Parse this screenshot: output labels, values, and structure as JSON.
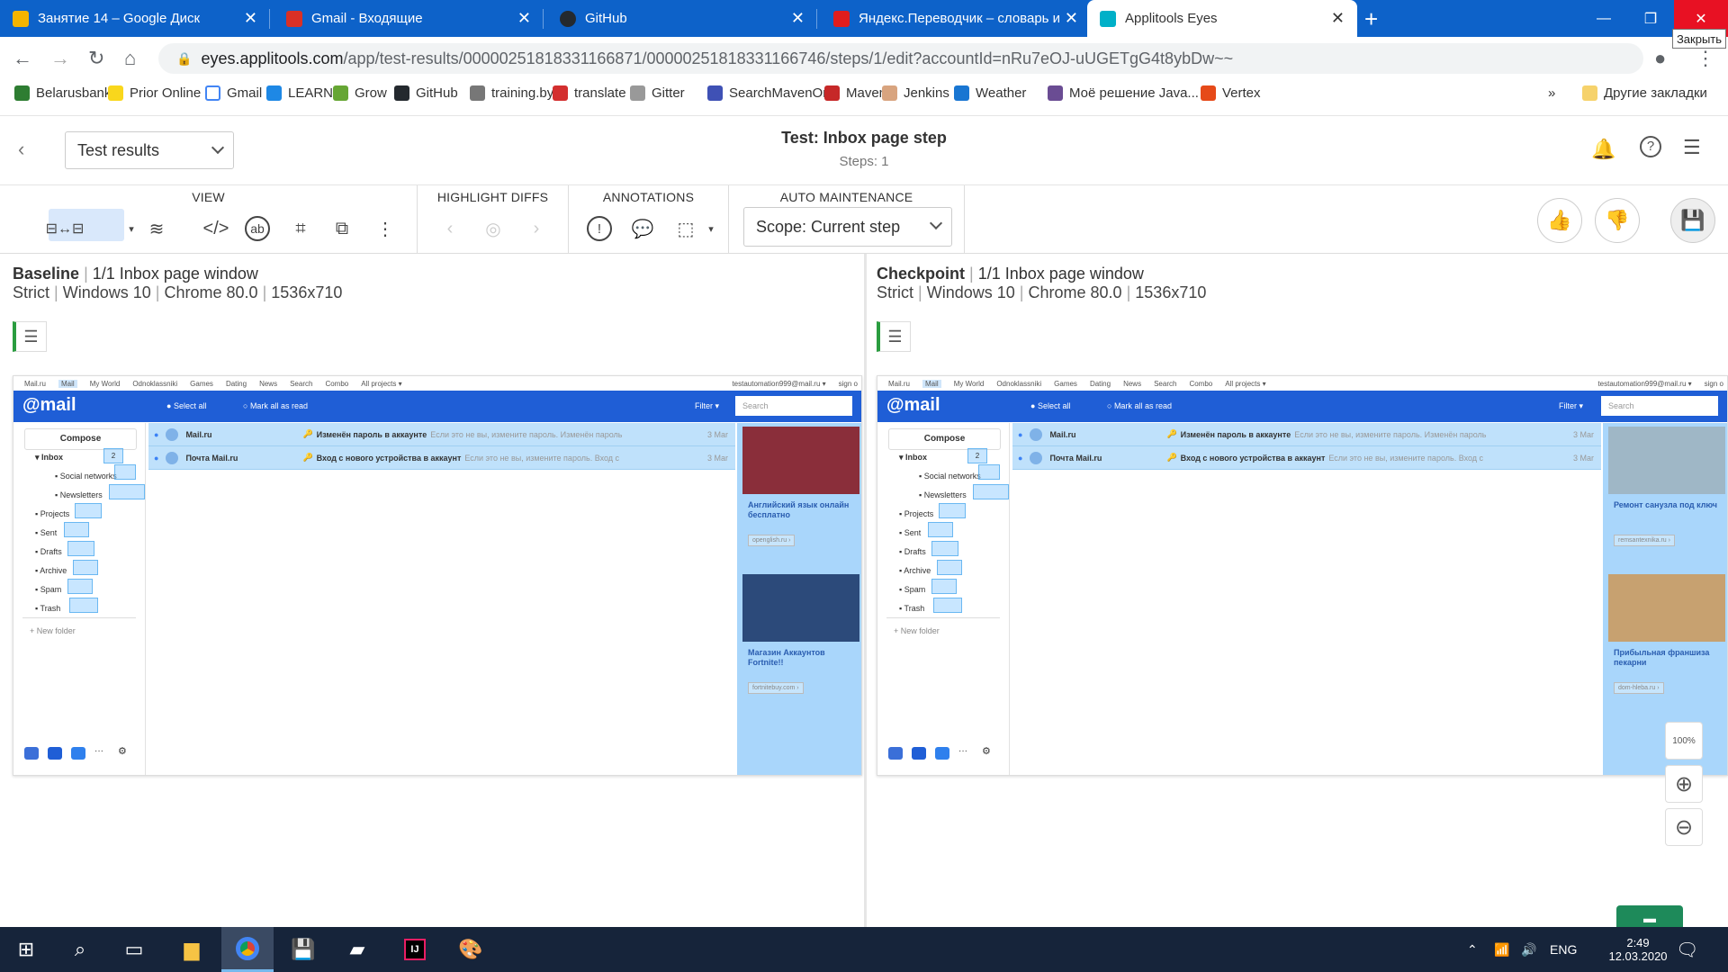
{
  "tabs": [
    {
      "label": "Занятие 14 – Google Диск",
      "color": "#f4b400"
    },
    {
      "label": "Gmail - Входящие",
      "color": "#d93025"
    },
    {
      "label": "GitHub",
      "color": "#24292e"
    },
    {
      "label": "Яндекс.Переводчик – словарь и",
      "color": "#e11d1d"
    },
    {
      "label": "Applitools Eyes",
      "color": "#00b0c8"
    }
  ],
  "window": {
    "close_tooltip": "Закрыть"
  },
  "address": {
    "host": "eyes.applitools.com",
    "path": "/app/test-results/00000251818331166871/00000251818331166746/steps/1/edit?accountId=nRu7eOJ-uUGETgG4t8ybDw~~"
  },
  "bookmarks": [
    {
      "label": "Belarusbank",
      "color": "#2e7d32"
    },
    {
      "label": "Prior Online",
      "color": "#f9d71c"
    },
    {
      "label": "Gmail",
      "color": "#ffffff"
    },
    {
      "label": "LEARN",
      "color": "#1e88e5"
    },
    {
      "label": "Grow",
      "color": "#66a634"
    },
    {
      "label": "GitHub",
      "color": "#24292e"
    },
    {
      "label": "training.by",
      "color": "#777777"
    },
    {
      "label": "translate",
      "color": "#d32f2f"
    },
    {
      "label": "Gitter",
      "color": "#999999"
    },
    {
      "label": "SearchMavenOrg",
      "color": "#3f51b5"
    },
    {
      "label": "Maven",
      "color": "#c62828"
    },
    {
      "label": "Jenkins",
      "color": "#d8a47f"
    },
    {
      "label": "Weather",
      "color": "#1976d2"
    },
    {
      "label": "Моё решение Java...",
      "color": "#6a4c93"
    },
    {
      "label": "Vertex",
      "color": "#e64a19"
    }
  ],
  "bookmarks_more": "»",
  "other_bookmarks": "Другие закладки",
  "appbar": {
    "dropdown": "Test results",
    "title": "Test: Inbox page step",
    "subtitle": "Steps: 1"
  },
  "toolbar": {
    "view_label": "VIEW",
    "highlight_label": "HIGHLIGHT DIFFS",
    "annotations_label": "ANNOTATIONS",
    "auto_label": "AUTO MAINTENANCE",
    "scope": "Scope: Current step"
  },
  "baseline": {
    "title": "Baseline",
    "window": "1/1 Inbox page window",
    "meta": [
      "Strict",
      "Windows 10",
      "Chrome 80.0",
      "1536x710"
    ]
  },
  "checkpoint": {
    "title": "Checkpoint",
    "window": "1/1 Inbox page window",
    "meta": [
      "Strict",
      "Windows 10",
      "Chrome 80.0",
      "1536x710"
    ]
  },
  "mail": {
    "top_links": [
      "Mail.ru",
      "Mail",
      "My World",
      "Odnoklassniki",
      "Games",
      "Dating",
      "News",
      "Search",
      "Combo",
      "All projects ▾"
    ],
    "account": "testautomation999@mail.ru ▾",
    "sign": "sign o",
    "logo": "@mail",
    "select_all": "Select all",
    "mark_read": "Mark all as read",
    "filter": "Filter ▾",
    "search": "Search",
    "compose": "Compose",
    "folders": [
      "Inbox",
      "Social networks",
      "Newsletters",
      "Projects",
      "Sent",
      "Drafts",
      "Archive",
      "Spam",
      "Trash"
    ],
    "inbox_count": "2",
    "new_folder": "New folder",
    "messages": [
      {
        "from": "Mail.ru",
        "subject": "Изменён пароль в аккаунте",
        "snippet": "Если это не вы, измените пароль. Изменён пароль",
        "date": "3 Mar"
      },
      {
        "from": "Почта Mail.ru",
        "subject": "Вход с нового устройства в аккаунт",
        "snippet": "Если это не вы, измените пароль. Вход с",
        "date": "3 Mar"
      }
    ]
  },
  "baseline_ads": [
    {
      "text": "Английский язык онлайн бесплатно",
      "link": "openglish.ru ›",
      "color": "#8a2e3a"
    },
    {
      "text": "Магазин Аккаунтов Fortnite!!",
      "link": "fortnitebuy.com ›",
      "color": "#2c4a7a"
    }
  ],
  "checkpoint_ads": [
    {
      "text": "Ремонт санузла под ключ",
      "link": "remsantexnika.ru ›",
      "color": "#9fb7c6"
    },
    {
      "text": "Прибыльная франшиза пекарни",
      "link": "dom-hleba.ru ›",
      "color": "#c7a170"
    }
  ],
  "zoom": {
    "label": "100%"
  },
  "taskbar": {
    "lang": "ENG",
    "time": "2:49",
    "date": "12.03.2020"
  }
}
